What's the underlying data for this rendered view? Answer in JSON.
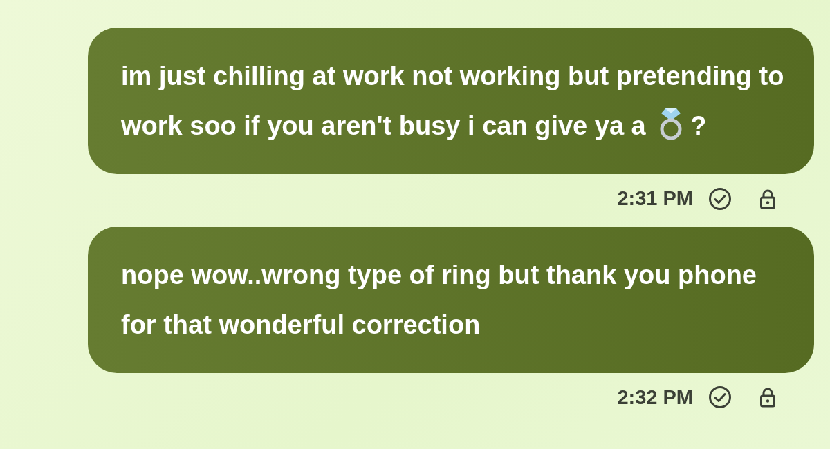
{
  "messages": [
    {
      "segments": [
        {
          "kind": "text",
          "text": "im just chilling at work not working but pretending to work soo if you aren't busy i can give ya a"
        },
        {
          "kind": "icon"
        },
        {
          "kind": "text",
          "text": "?"
        }
      ],
      "time": "2:31 PM",
      "delivered": true,
      "locked": true
    },
    {
      "segments": [
        {
          "kind": "text",
          "text": "nope wow..wrong type of ring but thank you phone for that wonderful correction"
        }
      ],
      "time": "2:32 PM",
      "delivered": true,
      "locked": true
    }
  ]
}
